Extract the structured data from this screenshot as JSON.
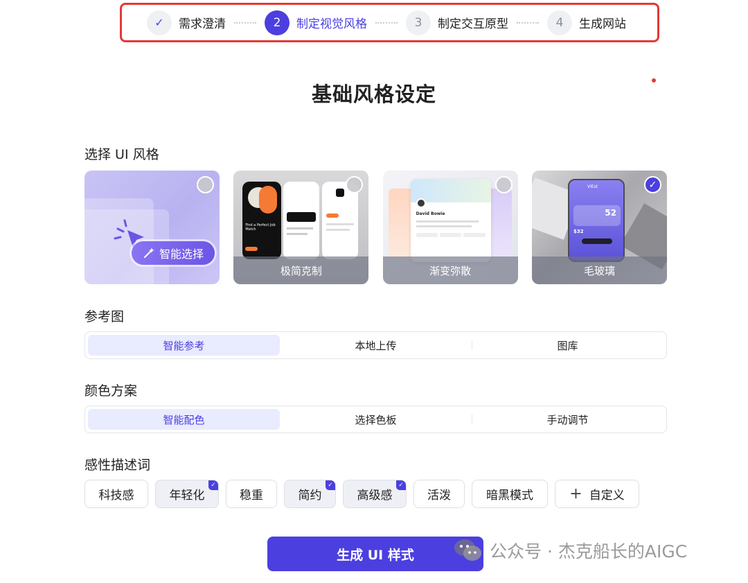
{
  "stepper": {
    "steps": [
      {
        "number": "✓",
        "label": "需求澄清",
        "state": "done"
      },
      {
        "number": "2",
        "label": "制定视觉风格",
        "state": "active"
      },
      {
        "number": "3",
        "label": "制定交互原型",
        "state": "pending"
      },
      {
        "number": "4",
        "label": "生成网站",
        "state": "pending"
      }
    ]
  },
  "page_title": "基础风格设定",
  "ui_style": {
    "label": "选择 UI 风格",
    "smart_choice": "智能选择",
    "cards": [
      {
        "caption": "",
        "selected": false
      },
      {
        "caption": "极简克制",
        "selected": false
      },
      {
        "caption": "渐变弥散",
        "selected": false
      },
      {
        "caption": "毛玻璃",
        "selected": true
      }
    ],
    "preview_text": {
      "minimal_headline": "Find a Perfect Job Match",
      "gradient_name": "David Bowie",
      "glass_brand": "VIEst",
      "glass_value": "52",
      "glass_price": "$32"
    }
  },
  "reference": {
    "label": "参考图",
    "options": [
      "智能参考",
      "本地上传",
      "图库"
    ],
    "active_index": 0
  },
  "color_scheme": {
    "label": "颜色方案",
    "options": [
      "智能配色",
      "选择色板",
      "手动调节"
    ],
    "active_index": 0
  },
  "descriptors": {
    "label": "感性描述词",
    "tags": [
      {
        "text": "科技感",
        "selected": false
      },
      {
        "text": "年轻化",
        "selected": true
      },
      {
        "text": "稳重",
        "selected": false
      },
      {
        "text": "简约",
        "selected": true
      },
      {
        "text": "高级感",
        "selected": true
      },
      {
        "text": "活泼",
        "selected": false
      },
      {
        "text": "暗黑模式",
        "selected": false
      }
    ],
    "custom": "自定义",
    "custom_icon": "plus-icon"
  },
  "generate_button": "生成 UI 样式",
  "watermark": "公众号 · 杰克船长的AIGC",
  "colors": {
    "accent": "#4b3fe0",
    "highlight_border": "#e53935"
  }
}
